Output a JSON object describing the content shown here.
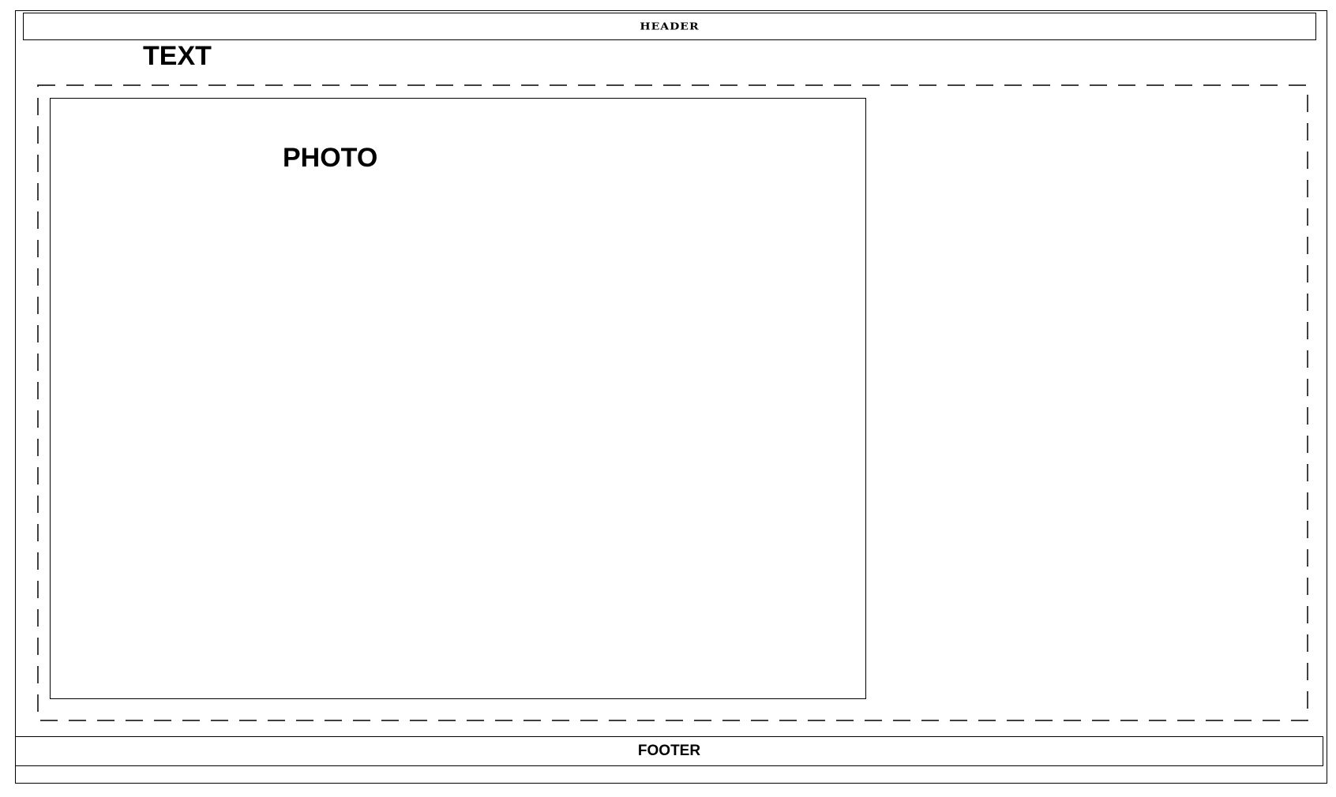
{
  "header": {
    "label": "HEADER"
  },
  "text_block": {
    "label": "TEXT"
  },
  "photo": {
    "label": "PHOTO"
  },
  "footer": {
    "label": "FOOTER"
  },
  "colors": {
    "stroke": "#000000",
    "background": "#ffffff"
  }
}
